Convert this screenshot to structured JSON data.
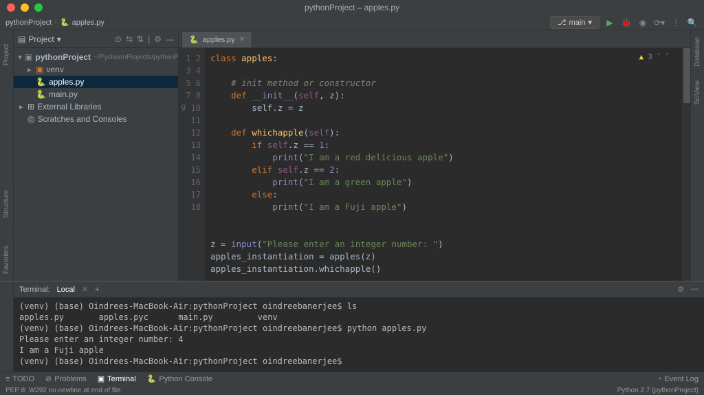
{
  "titlebar": {
    "title": "pythonProject – apples.py"
  },
  "crumbs": {
    "project": "pythonProject",
    "file": "apples.py"
  },
  "runconfig": {
    "branch": "main"
  },
  "sidebar": {
    "title": "Project",
    "root": {
      "name": "pythonProject",
      "path": "~/PycharmProjects/pythonProje"
    },
    "venv": "venv",
    "files": [
      "apples.py",
      "main.py"
    ],
    "ext": "External Libraries",
    "scratch": "Scratches and Consoles"
  },
  "editor": {
    "tab": "apples.py",
    "warnings": "3",
    "lines": [
      1,
      2,
      3,
      4,
      5,
      6,
      7,
      8,
      9,
      10,
      11,
      12,
      13,
      14,
      15,
      16,
      17,
      18
    ],
    "code": {
      "l1": [
        "class ",
        "apples",
        ":"
      ],
      "l3": "    # init method or constructor",
      "l4": [
        "    def ",
        "__init__",
        "(",
        "self",
        ", ",
        "z",
        "):"
      ],
      "l5": "        self.z = z",
      "l7": [
        "    def ",
        "whichapple",
        "(",
        "self",
        "):"
      ],
      "l8": [
        "        if ",
        "self",
        ".z == ",
        "1",
        ":"
      ],
      "l9": [
        "            print",
        "(",
        "\"I am a red delicious apple\"",
        ")"
      ],
      "l10": [
        "        elif ",
        "self",
        ".z == ",
        "2",
        ":"
      ],
      "l11": [
        "            print",
        "(",
        "\"I am a green apple\"",
        ")"
      ],
      "l12": [
        "        else",
        ":"
      ],
      "l13": [
        "            print",
        "(",
        "\"I am a Fuji apple\"",
        ")"
      ],
      "l16": [
        "z = ",
        "input",
        "(",
        "\"Please enter an integer number: \"",
        ")"
      ],
      "l17": [
        "apples_instantiation = apples(z)"
      ],
      "l18": [
        "apples_instantiation.whichapple()"
      ]
    }
  },
  "terminal": {
    "title": "Terminal:",
    "tab": "Local",
    "lines": [
      "(venv) (base) Oindrees-MacBook-Air:pythonProject oindreebanerjee$ ls",
      "apples.py       apples.pyc      main.py         venv",
      "(venv) (base) Oindrees-MacBook-Air:pythonProject oindreebanerjee$ python apples.py",
      "Please enter an integer number: 4",
      "I am a Fuji apple",
      "(venv) (base) Oindrees-MacBook-Air:pythonProject oindreebanerjee$"
    ]
  },
  "toolwin": {
    "todo": "TODO",
    "problems": "Problems",
    "terminal": "Terminal",
    "pyconsole": "Python Console",
    "eventlog": "Event Log"
  },
  "status": {
    "msg": "PEP 8: W292 no newline at end of file",
    "interp": "Python 2.7 (pythonProject)"
  },
  "right": {
    "db": "Database",
    "sci": "SciView"
  },
  "left": {
    "struct": "Structure",
    "fav": "Favorites",
    "proj": "Project"
  }
}
